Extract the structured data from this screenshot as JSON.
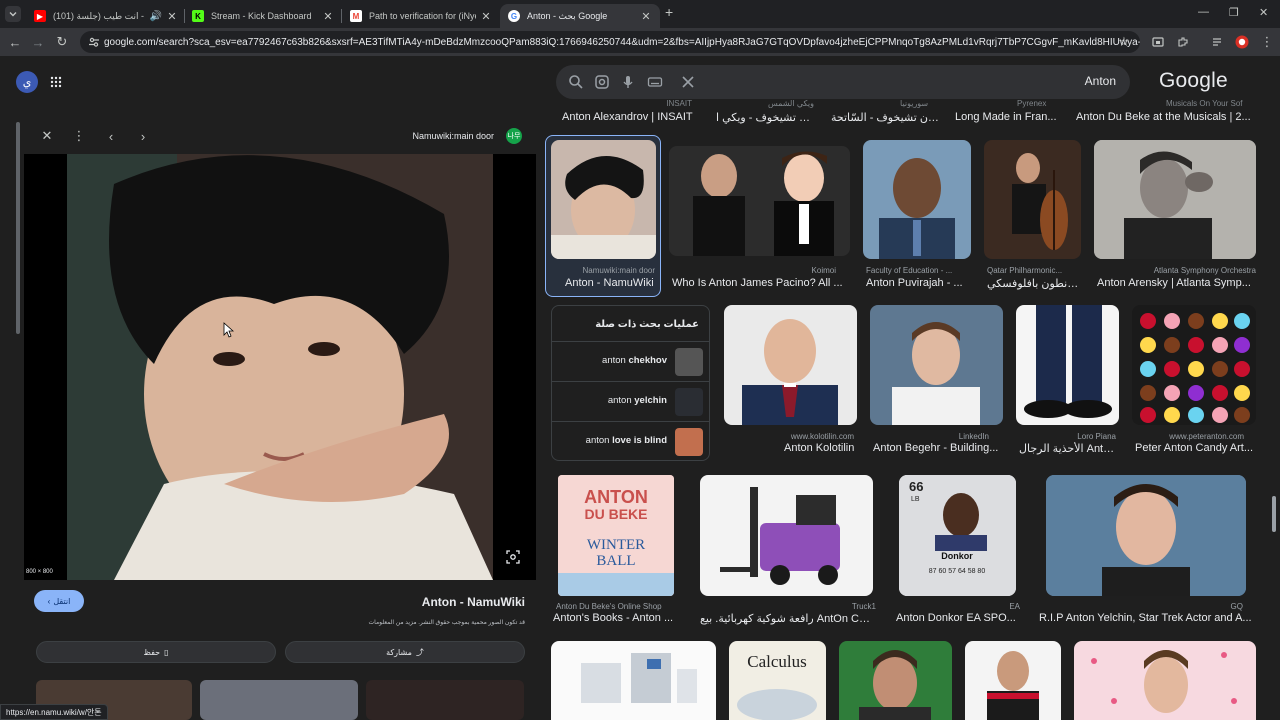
{
  "browser": {
    "tabs": [
      {
        "label": "(101) توال - انت طيب (جلسة",
        "favicon": "youtube-favicon",
        "active": false
      },
      {
        "label": "Stream - Kick Dashboard",
        "favicon": "kick-favicon",
        "active": false
      },
      {
        "label": "Path to verification for (iNyez",
        "favicon": "gmail-favicon",
        "active": false
      },
      {
        "label": "Anton - بحث Google",
        "favicon": "google-favicon",
        "active": true
      }
    ],
    "new_tab": "+",
    "url": "google.com/search?sca_esv=ea7792467c63b826&sxsrf=AE3TifMTiA4y-mDeBdzMmzcooQPam883iQ:1766946250744&udm=2&fbs=AIIjpHya8RJaG7GTqOVDpfavo4jzheEjCPPMnqoTg8AzPMLd1vRqrj7TbP7CGgvF_mKavld8HIUwya-jo76QaaoLBYp..."
  },
  "header": {
    "avatar_letter": "ي",
    "search_query": "Anton",
    "logo": "Google"
  },
  "preview": {
    "source_name": "Namuwiki:main door",
    "source_badge": "나무",
    "image_size": "800 × 800",
    "visit_label": "انتقل",
    "title": "Anton - NamuWiki",
    "copyright_note": "قد تكون الصور محمية بموجب حقوق النشر. مزيد من المعلومات",
    "save_label": "حفظ",
    "share_label": "مشاركة"
  },
  "cut_row": [
    "Anton Alexandrov | INSAIT",
    "أنطون تشيخوف - ويكي ا...",
    "أنطون تشيخوف - السّاتحة",
    "Long Made in Fran...",
    "Anton Du Beke at the Musicals | 2..."
  ],
  "cut_sources": [
    "INSAIT",
    "ويكي الشمس",
    "سوريونيا",
    "Pyrenex",
    "Musicals On Your Sof"
  ],
  "row1": [
    {
      "source": "Namuwiki:main door",
      "title": "Anton - NamuWiki",
      "selected": true
    },
    {
      "source": "Koimoi",
      "title": "Who Is Anton James Pacino? All ..."
    },
    {
      "source": "Faculty of Education - ...",
      "title": "Anton Puvirajah - ..."
    },
    {
      "source": "Qatar Philharmonic...",
      "title": "أنطون بافلوفسكي - Q..."
    },
    {
      "source": "Atlanta Symphony Orchestra",
      "title": "Anton Arensky | Atlanta Symp..."
    }
  ],
  "related": {
    "heading": "عمليات بحث ذات صلة",
    "items": [
      {
        "prefix": "anton",
        "bold": "chekhov"
      },
      {
        "prefix": "anton",
        "bold": "yelchin"
      },
      {
        "prefix": "anton",
        "bold": "love is blind"
      }
    ]
  },
  "row2": [
    {
      "source": "www.kolotilin.com",
      "title": "Anton Kolotilin"
    },
    {
      "source": "LinkedIn",
      "title": "Anton Begehr - Building..."
    },
    {
      "source": "Loro Piana",
      "title": "الأحذية الرجال Anton ..."
    },
    {
      "source": "www.peteranton.com",
      "title": "Peter Anton Candy Art..."
    }
  ],
  "row3": [
    {
      "source": "Anton Du Beke's Online Shop",
      "title": "Anton's Books - Anton ..."
    },
    {
      "source": "Truck1",
      "title": "رافعة شوكية كهربائية. بيع AntOn CBH 3.0"
    },
    {
      "source": "EA",
      "title": "Anton Donkor EA SPO..."
    },
    {
      "source": "GQ",
      "title": "R.I.P Anton Yelchin, Star Trek Actor and A..."
    }
  ],
  "book_cover": {
    "line1": "ANTON",
    "line2": "DU BEKE",
    "line3": "WINTER",
    "line4": "BALL"
  },
  "fifa_card": {
    "rating": "66",
    "pos": "LB",
    "name": "Donkor",
    "stats": "87 60 57 64 58 80"
  },
  "calculus_cover": "Calculus",
  "status_url": "https://en.namu.wiki/w/안톤"
}
